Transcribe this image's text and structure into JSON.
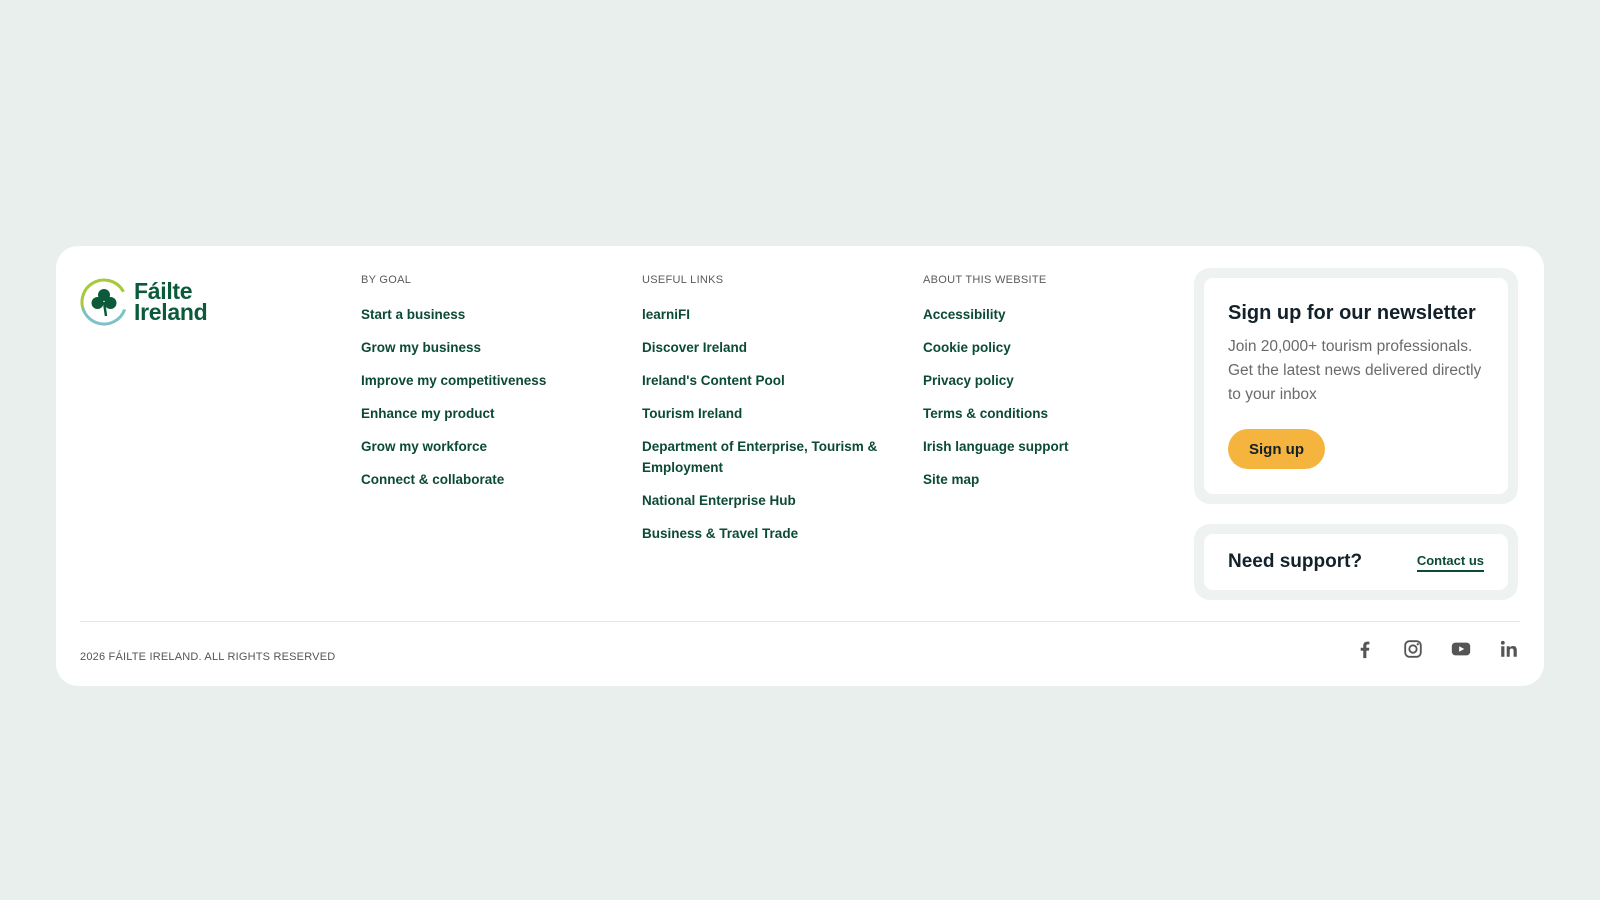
{
  "brand": {
    "name_line1": "Fáilte",
    "name_line2": "Ireland"
  },
  "columns": [
    {
      "heading": "BY GOAL",
      "links": [
        "Start a business",
        "Grow my business",
        "Improve my competitiveness",
        "Enhance my product",
        "Grow my workforce",
        "Connect & collaborate"
      ]
    },
    {
      "heading": "USEFUL LINKS",
      "links": [
        "learniFI",
        "Discover Ireland",
        "Ireland's Content Pool",
        "Tourism Ireland",
        "Department of Enterprise, Tourism & Employment",
        "National Enterprise Hub",
        "Business & Travel Trade"
      ]
    },
    {
      "heading": "ABOUT THIS WEBSITE",
      "links": [
        "Accessibility",
        "Cookie policy",
        "Privacy policy",
        "Terms & conditions",
        "Irish language support",
        "Site map"
      ]
    }
  ],
  "newsletter": {
    "title": "Sign up for our newsletter",
    "description": "Join 20,000+ tourism professionals. Get the latest news delivered directly to your inbox",
    "button_label": "Sign up"
  },
  "support": {
    "title": "Need support?",
    "link_label": "Contact us"
  },
  "copyright": "2026 FÁILTE IRELAND. ALL RIGHTS RESERVED",
  "social_icons": [
    "facebook-icon",
    "instagram-icon",
    "youtube-icon",
    "linkedin-icon"
  ],
  "colors": {
    "page_bg": "#e8efec",
    "brand_green": "#0b4a33",
    "accent_yellow": "#f5b43d",
    "card_bg": "#ffffff"
  }
}
